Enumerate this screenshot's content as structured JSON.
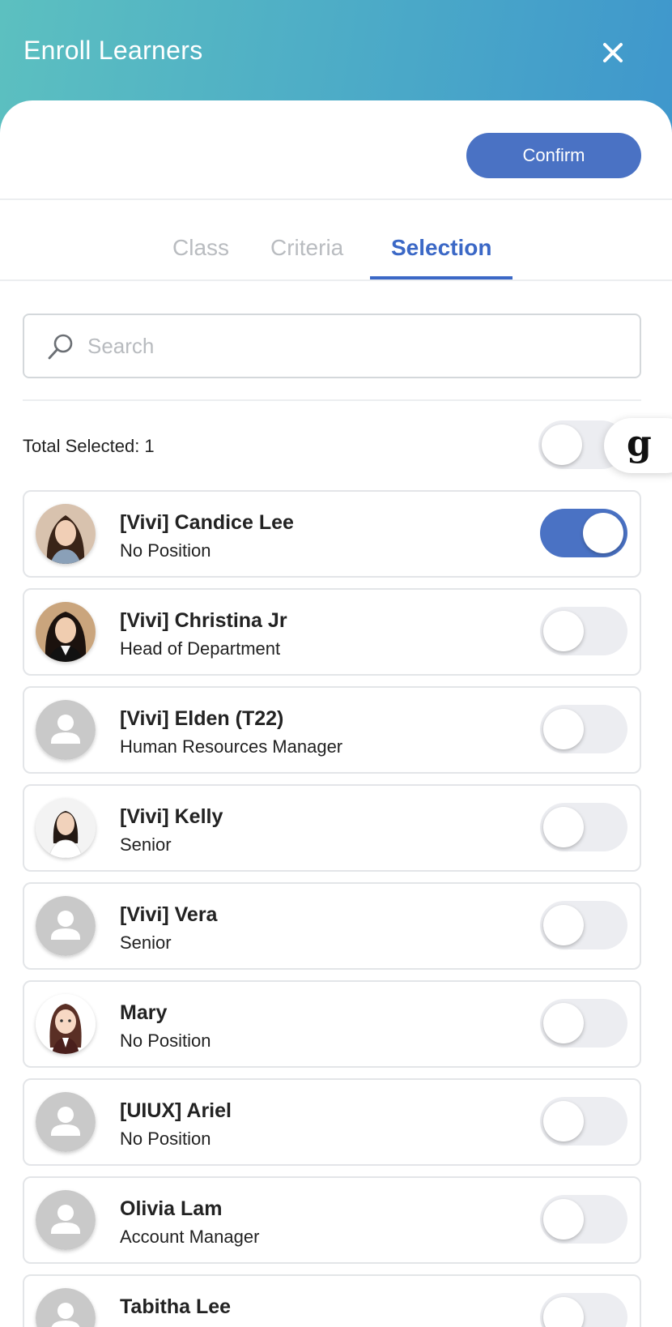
{
  "header": {
    "title": "Enroll Learners"
  },
  "toolbar": {
    "confirm_label": "Confirm"
  },
  "tabs": [
    {
      "label": "Class",
      "active": false
    },
    {
      "label": "Criteria",
      "active": false
    },
    {
      "label": "Selection",
      "active": true
    }
  ],
  "search": {
    "placeholder": "Search",
    "value": ""
  },
  "summary": {
    "total_selected": "Total Selected: 1",
    "select_all": false
  },
  "fab": {
    "letter": "g"
  },
  "colors": {
    "accent": "#4a72c4",
    "tab_active": "#3b68c6",
    "header_start": "#5cc0c0",
    "header_end": "#3f97cc"
  },
  "learners": [
    {
      "name": "[Vivi] Candice Lee",
      "position": "No Position",
      "selected": true,
      "avatar": "photo-woman-1"
    },
    {
      "name": "[Vivi] Christina Jr",
      "position": "Head of Department",
      "selected": false,
      "avatar": "photo-woman-2"
    },
    {
      "name": "[Vivi] Elden (T22)",
      "position": "Human Resources Manager",
      "selected": false,
      "avatar": "default-person-icon"
    },
    {
      "name": "[Vivi] Kelly",
      "position": "Senior",
      "selected": false,
      "avatar": "photo-woman-3"
    },
    {
      "name": "[Vivi] Vera",
      "position": "Senior",
      "selected": false,
      "avatar": "default-person-icon"
    },
    {
      "name": "Mary",
      "position": "No Position",
      "selected": false,
      "avatar": "illustration-woman"
    },
    {
      "name": "[UIUX] Ariel",
      "position": "No Position",
      "selected": false,
      "avatar": "default-person-icon"
    },
    {
      "name": "Olivia Lam",
      "position": "Account Manager",
      "selected": false,
      "avatar": "default-person-icon"
    },
    {
      "name": "Tabitha Lee",
      "position": "",
      "selected": false,
      "avatar": "default-person-icon"
    }
  ]
}
